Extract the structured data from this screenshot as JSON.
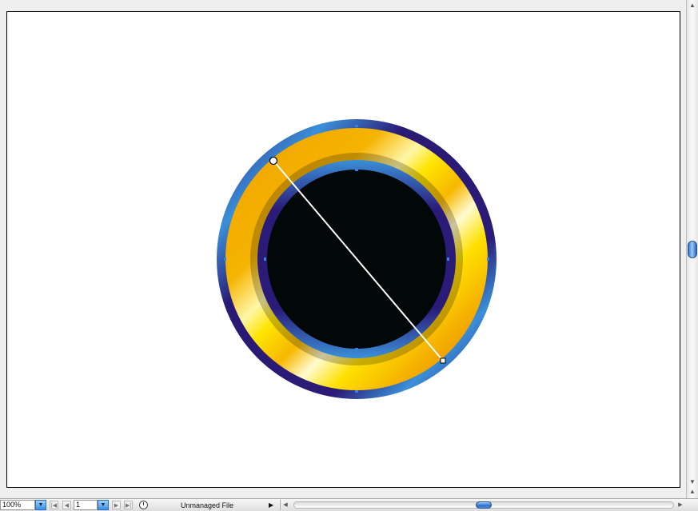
{
  "statusbar": {
    "zoom": "100%",
    "page": "1",
    "status": "Unmanaged File",
    "status_menu_icon": "triangle-right-icon"
  },
  "colors": {
    "ring_orange": "#f4a100",
    "ring_yellow": "#ffe600",
    "ring_navy": "#2b1a78",
    "rim_blue": "#3a8fd8",
    "center": "#020807",
    "selection": "#3a7fd8",
    "scroll_thumb": "#2f6fc6"
  }
}
